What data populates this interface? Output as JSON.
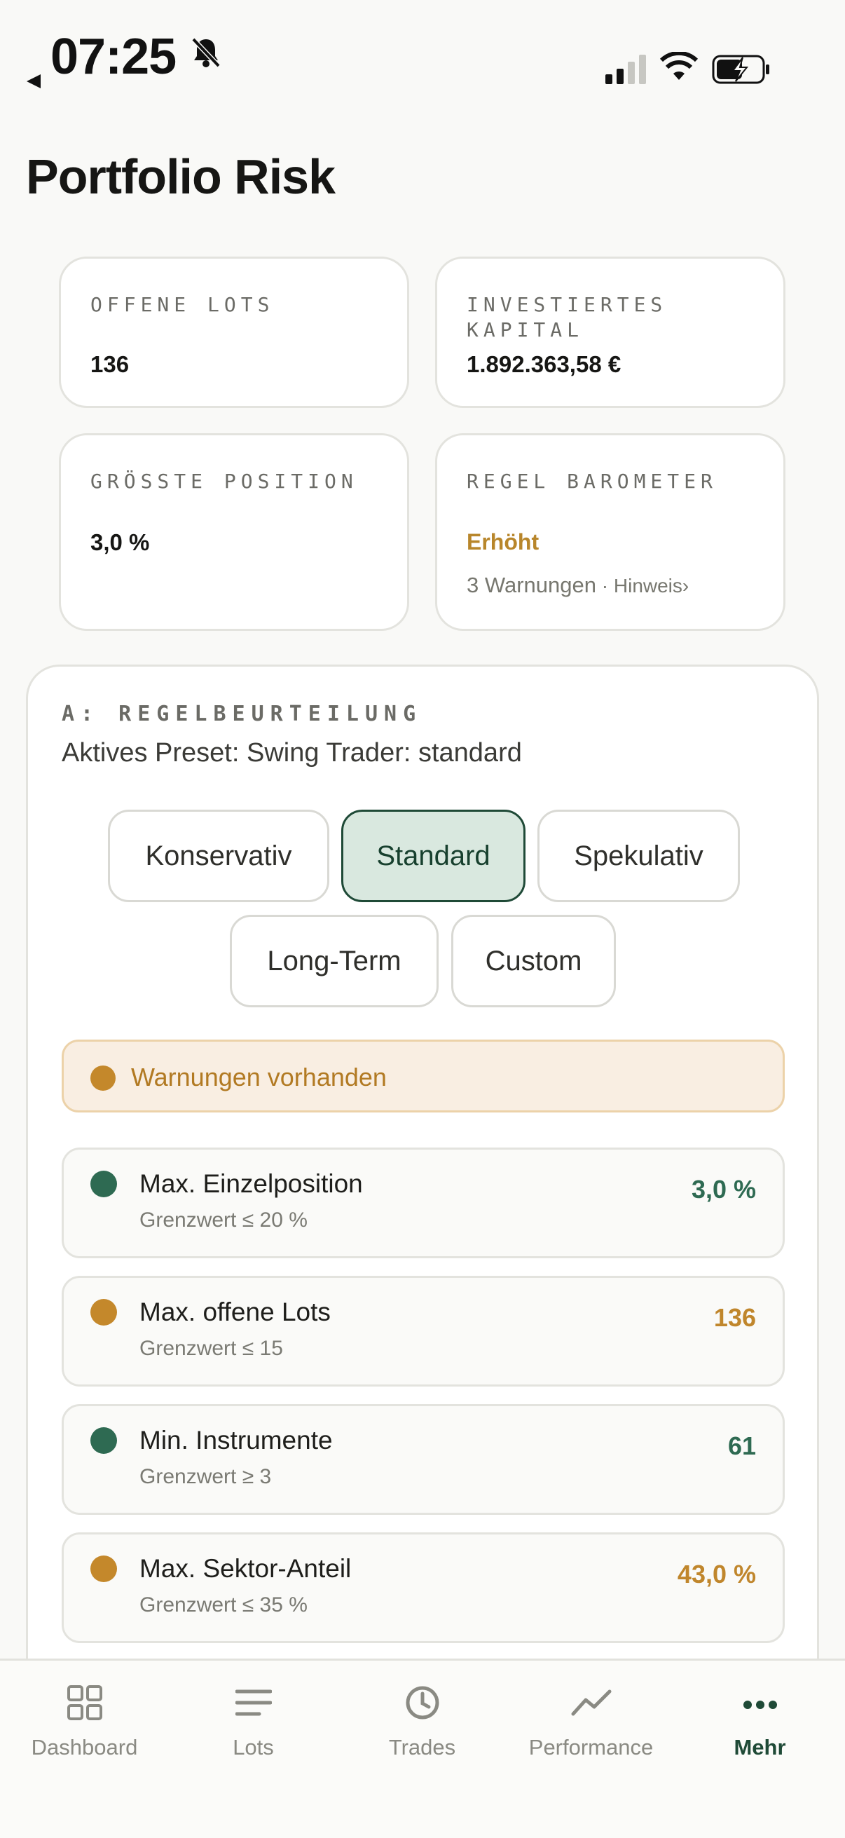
{
  "status": {
    "time": "07:25"
  },
  "page": {
    "title": "Portfolio Risk"
  },
  "stats": {
    "open_lots": {
      "label": "OFFENE LOTS",
      "value": "136"
    },
    "invested": {
      "label_line1": "INVESTIERTES",
      "label_line2": "KAPITAL",
      "value": "1.892.363,58 €"
    },
    "largest": {
      "label": "GRÖSSTE POSITION",
      "value": "3,0 %"
    },
    "barometer": {
      "label": "REGEL BAROMETER",
      "state": "Erhöht",
      "warnings": "3 Warnungen",
      "separator": " · ",
      "hint": "Hinweis›"
    }
  },
  "rules": {
    "section_label": "A: REGELBEURTEILUNG",
    "active_preset": "Aktives Preset: Swing Trader: standard",
    "presets": [
      "Konservativ",
      "Standard",
      "Spekulativ",
      "Long-Term",
      "Custom"
    ],
    "selected_preset": "Standard",
    "banner": "Warnungen vorhanden",
    "items": [
      {
        "name": "Max. Einzelposition",
        "limit": "Grenzwert ≤ 20 %",
        "value": "3,0 %",
        "status": "ok"
      },
      {
        "name": "Max. offene Lots",
        "limit": "Grenzwert ≤ 15",
        "value": "136",
        "status": "warn"
      },
      {
        "name": "Min. Instrumente",
        "limit": "Grenzwert ≥ 3",
        "value": "61",
        "status": "ok"
      },
      {
        "name": "Max. Sektor-Anteil",
        "limit": "Grenzwert ≤ 35 %",
        "value": "43,0 %",
        "status": "warn"
      }
    ]
  },
  "colors": {
    "ok": "#2e6a52",
    "warn": "#c4882b",
    "accent": "#1f4a37"
  },
  "tabbar": {
    "items": [
      {
        "label": "Dashboard",
        "icon": "grid-icon"
      },
      {
        "label": "Lots",
        "icon": "list-icon"
      },
      {
        "label": "Trades",
        "icon": "clock-icon"
      },
      {
        "label": "Performance",
        "icon": "trend-icon"
      },
      {
        "label": "Mehr",
        "icon": "more-icon"
      }
    ],
    "active": "Mehr"
  }
}
